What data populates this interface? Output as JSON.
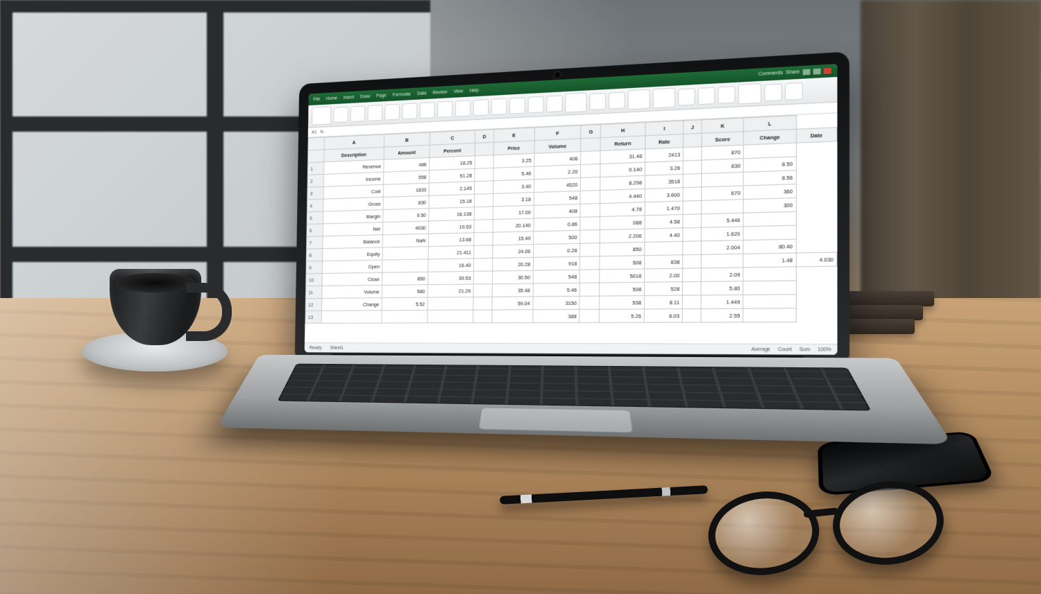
{
  "titlebar": {
    "tabs": [
      "File",
      "Home",
      "Insert",
      "Draw",
      "Page",
      "Formulas",
      "Data",
      "Review",
      "View",
      "Help"
    ],
    "right": [
      "Comments",
      "Share"
    ]
  },
  "formula_bar": {
    "cell_ref": "A1",
    "fx": "fx"
  },
  "columns": [
    "",
    "A",
    "B",
    "C",
    "D",
    "E",
    "F",
    "G",
    "H",
    "I",
    "J",
    "K",
    "L"
  ],
  "header_row": [
    "",
    "Description",
    "Amount",
    "Percent",
    "",
    "Price",
    "Volume",
    "",
    "Return",
    "Rate",
    "",
    "Score",
    "Change",
    "Date"
  ],
  "rows": [
    [
      "1",
      "Revenue",
      "486",
      "18.25",
      "",
      "3.25",
      "406",
      "",
      "31.48",
      "2413",
      "",
      "870",
      ""
    ],
    [
      "2",
      "Income",
      "558",
      "51.28",
      "",
      "5.46",
      "2.20",
      "",
      "0.140",
      "3.26",
      "",
      "830",
      "8.50"
    ],
    [
      "3",
      "Cost",
      "1833",
      "2.145",
      "",
      "3.40",
      "4520",
      "",
      "8.298",
      "3518",
      "",
      "",
      "8.56"
    ],
    [
      "4",
      "Gross",
      "830",
      "15.18",
      "",
      "3.18",
      "548",
      "",
      "4.440",
      "3.600",
      "",
      "670",
      "360"
    ],
    [
      "5",
      "Margin",
      "9.50",
      "16.138",
      "",
      "17.00",
      "408",
      "",
      "4.78",
      "1.470",
      "",
      "",
      "300"
    ],
    [
      "6",
      "Net",
      "4030",
      "19.53",
      "",
      "20.140",
      "0.86",
      "",
      "088",
      "4.58",
      "",
      "5.446",
      ""
    ],
    [
      "7",
      "Balance",
      "NaN",
      "13.68",
      "",
      "15.49",
      "500",
      "",
      "2.206",
      "4.40",
      "",
      "1.620",
      ""
    ],
    [
      "8",
      "Equity",
      "",
      "21.411",
      "",
      "24.06",
      "0.28",
      "",
      "850",
      "",
      "",
      "2.004",
      "80.40"
    ],
    [
      "9",
      "Open",
      "",
      "16.40",
      "",
      "20.28",
      "918",
      "",
      "508",
      "838",
      "",
      "",
      "1.48",
      "4.030"
    ],
    [
      "10",
      "Close",
      "850",
      "39.53",
      "",
      "30.50",
      "548",
      "",
      "5018",
      "2.00",
      "",
      "2.09",
      ""
    ],
    [
      "11",
      "Volume",
      "580",
      "21.29",
      "",
      "35.48",
      "5.46",
      "",
      "508",
      "528",
      "",
      "5.80",
      ""
    ],
    [
      "12",
      "Change",
      "5.52",
      "",
      "",
      "59.04",
      "3150",
      "",
      "538",
      "8.11",
      "",
      "1.449",
      ""
    ],
    [
      "13",
      "",
      "",
      "",
      "",
      "",
      "388",
      "",
      "5.26",
      "8.03",
      "",
      "2.55",
      ""
    ]
  ],
  "statusbar": {
    "left": "Ready",
    "sheet": "Sheet1",
    "right": [
      "Average",
      "Count",
      "Sum",
      "100%"
    ]
  }
}
